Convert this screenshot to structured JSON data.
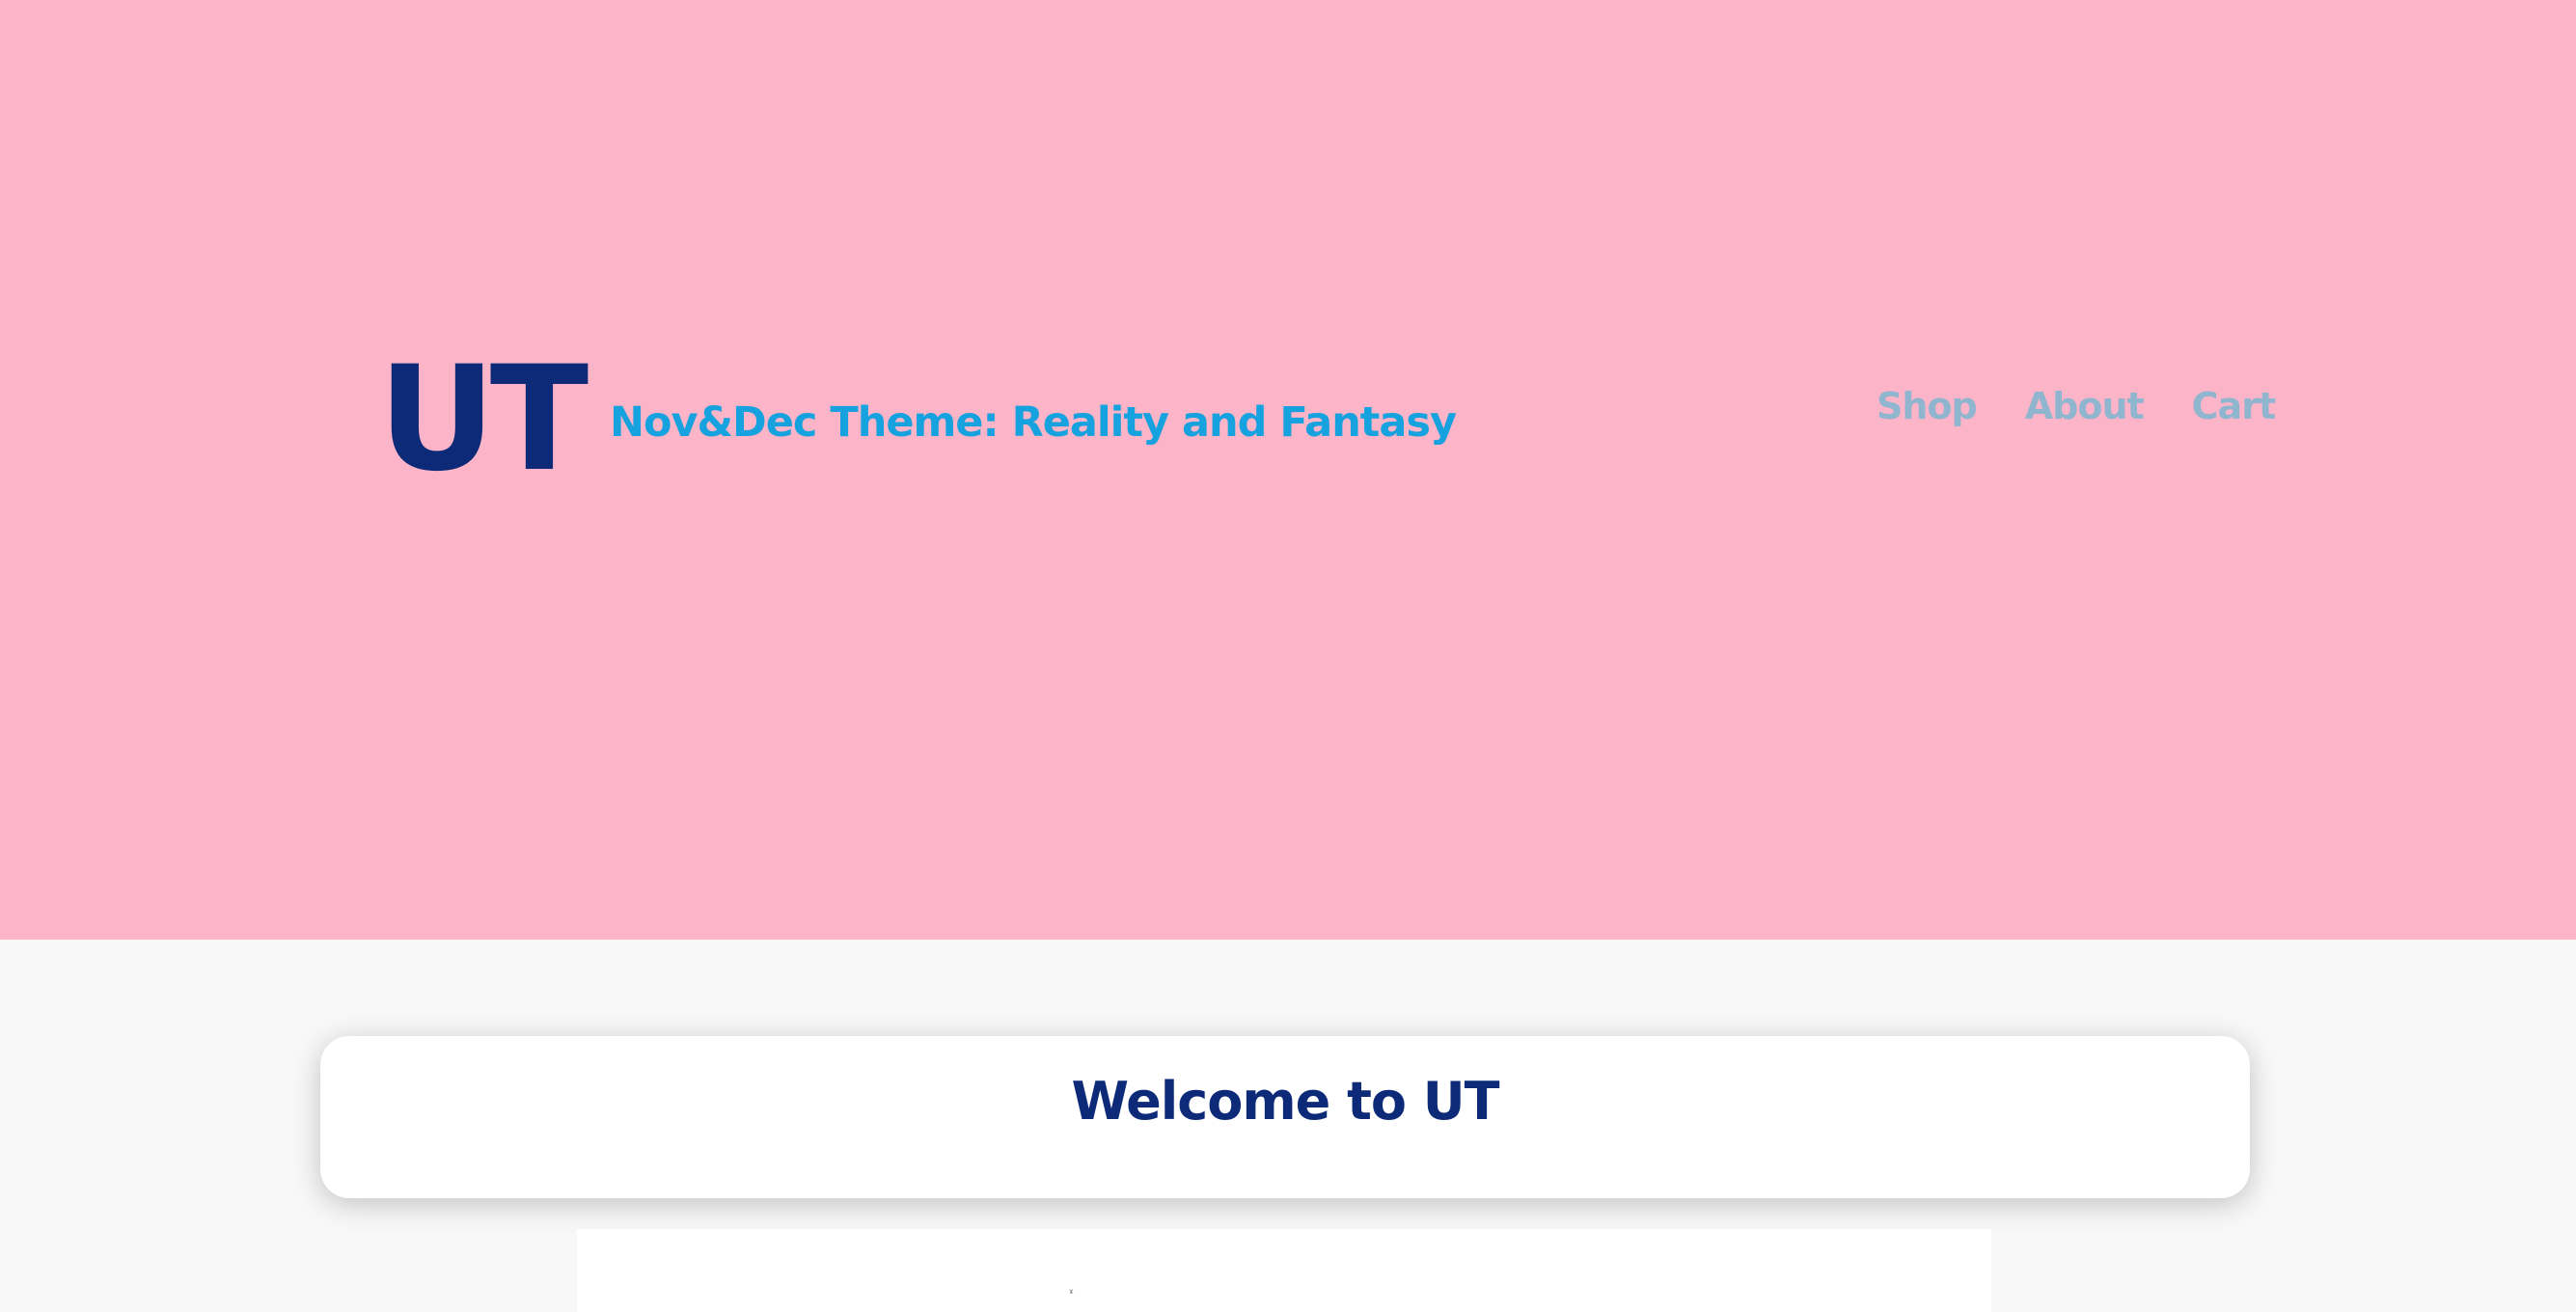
{
  "header": {
    "logo": "UT",
    "tagline": "Nov&Dec Theme: Reality and Fantasy",
    "nav": [
      {
        "label": "Shop"
      },
      {
        "label": "About"
      },
      {
        "label": "Cart"
      }
    ]
  },
  "main": {
    "welcome_title": "Welcome to UT",
    "content_mark": "ɤ"
  },
  "colors": {
    "hero_bg": "#fbb4c8",
    "logo": "#0c2a78",
    "tagline": "#16a2de",
    "nav": "#8fb5cf",
    "page_bg": "#f8f8f8"
  }
}
